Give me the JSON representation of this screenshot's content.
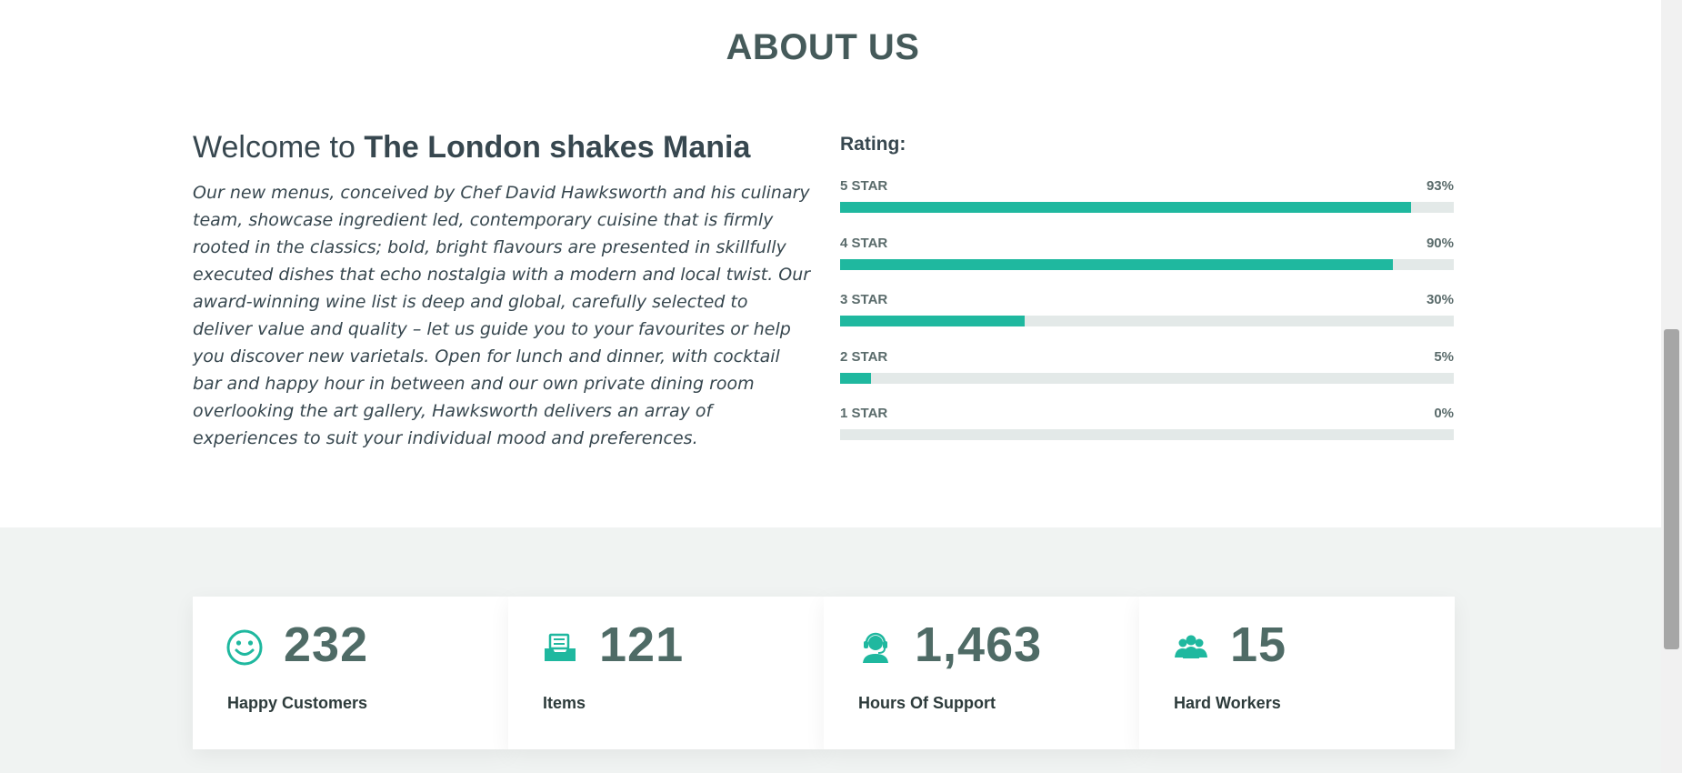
{
  "about": {
    "section_title": "ABOUT US",
    "welcome_prefix": "Welcome to",
    "welcome_name": "The London shakes Mania",
    "description": "Our new menus, conceived by Chef David Hawksworth and his culinary team, showcase ingredient led, contemporary cuisine that is firmly rooted in the classics; bold, bright flavours are presented in skillfully executed dishes that echo nostalgia with a modern and local twist. Our award-winning wine list is deep and global, carefully selected to deliver value and quality – let us guide you to your favourites or help you discover new varietals. Open for lunch and dinner, with cocktail bar and happy hour in between and our own private dining room overlooking the art gallery, Hawksworth delivers an array of experiences to suit your individual mood and preferences."
  },
  "rating": {
    "title": "Rating:",
    "bars": [
      {
        "label": "5 STAR",
        "percent_text": "93%",
        "percent": 93
      },
      {
        "label": "4 STAR",
        "percent_text": "90%",
        "percent": 90
      },
      {
        "label": "3 STAR",
        "percent_text": "30%",
        "percent": 30
      },
      {
        "label": "2 STAR",
        "percent_text": "5%",
        "percent": 5
      },
      {
        "label": "1 STAR",
        "percent_text": "0%",
        "percent": 0
      }
    ],
    "accent_color": "#1fb89f",
    "track_color": "#e3e9e8"
  },
  "stats": [
    {
      "icon": "smile-icon",
      "number": "232",
      "caption": "Happy Customers"
    },
    {
      "icon": "tray-icon",
      "number": "121",
      "caption": "Items"
    },
    {
      "icon": "headset-support-icon",
      "number": "1,463",
      "caption": "Hours Of Support"
    },
    {
      "icon": "group-users-icon",
      "number": "15",
      "caption": "Hard Workers"
    }
  ]
}
